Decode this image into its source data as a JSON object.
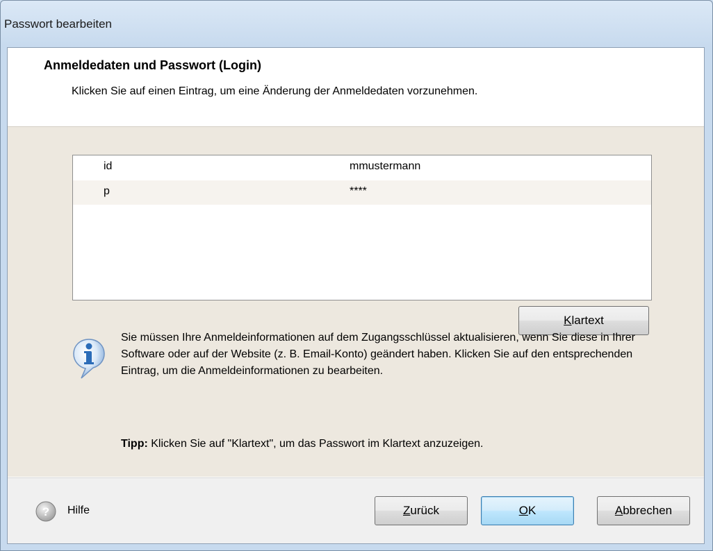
{
  "window": {
    "title": "Passwort bearbeiten"
  },
  "header": {
    "title": "Anmeldedaten und Passwort (Login)",
    "description": "Klicken Sie auf einen Eintrag, um eine Änderung der Anmeldedaten vorzunehmen."
  },
  "credentials": {
    "rows": [
      {
        "field": "id",
        "value": "mmustermann"
      },
      {
        "field": "p",
        "value": "****"
      }
    ]
  },
  "buttons": {
    "plaintext_prefix": "K",
    "plaintext_rest": "lartext",
    "back_prefix": "Z",
    "back_rest": "urück",
    "ok_prefix": "O",
    "ok_rest": "K",
    "cancel_prefix": "A",
    "cancel_rest": "bbrechen"
  },
  "info": {
    "text": "Sie müssen Ihre Anmeldeinformationen auf dem Zugangsschlüssel aktualisieren, wenn Sie diese in Ihrer Software oder auf der Website (z. B. Email-Konto) geändert haben. Klicken Sie auf den entsprechenden Eintrag, um die Anmeldeinformationen zu bearbeiten.",
    "tip_label": "Tipp:",
    "tip_text": " Klicken Sie auf \"Klartext\", um das Passwort im Klartext anzuzeigen.",
    "icon": "info-icon"
  },
  "footer": {
    "help_label": "Hilfe",
    "help_icon": "help-question-icon"
  },
  "colors": {
    "content_bg": "#ede8df",
    "default_button": "#bee6fd",
    "info_blue": "#2b6cb8"
  }
}
